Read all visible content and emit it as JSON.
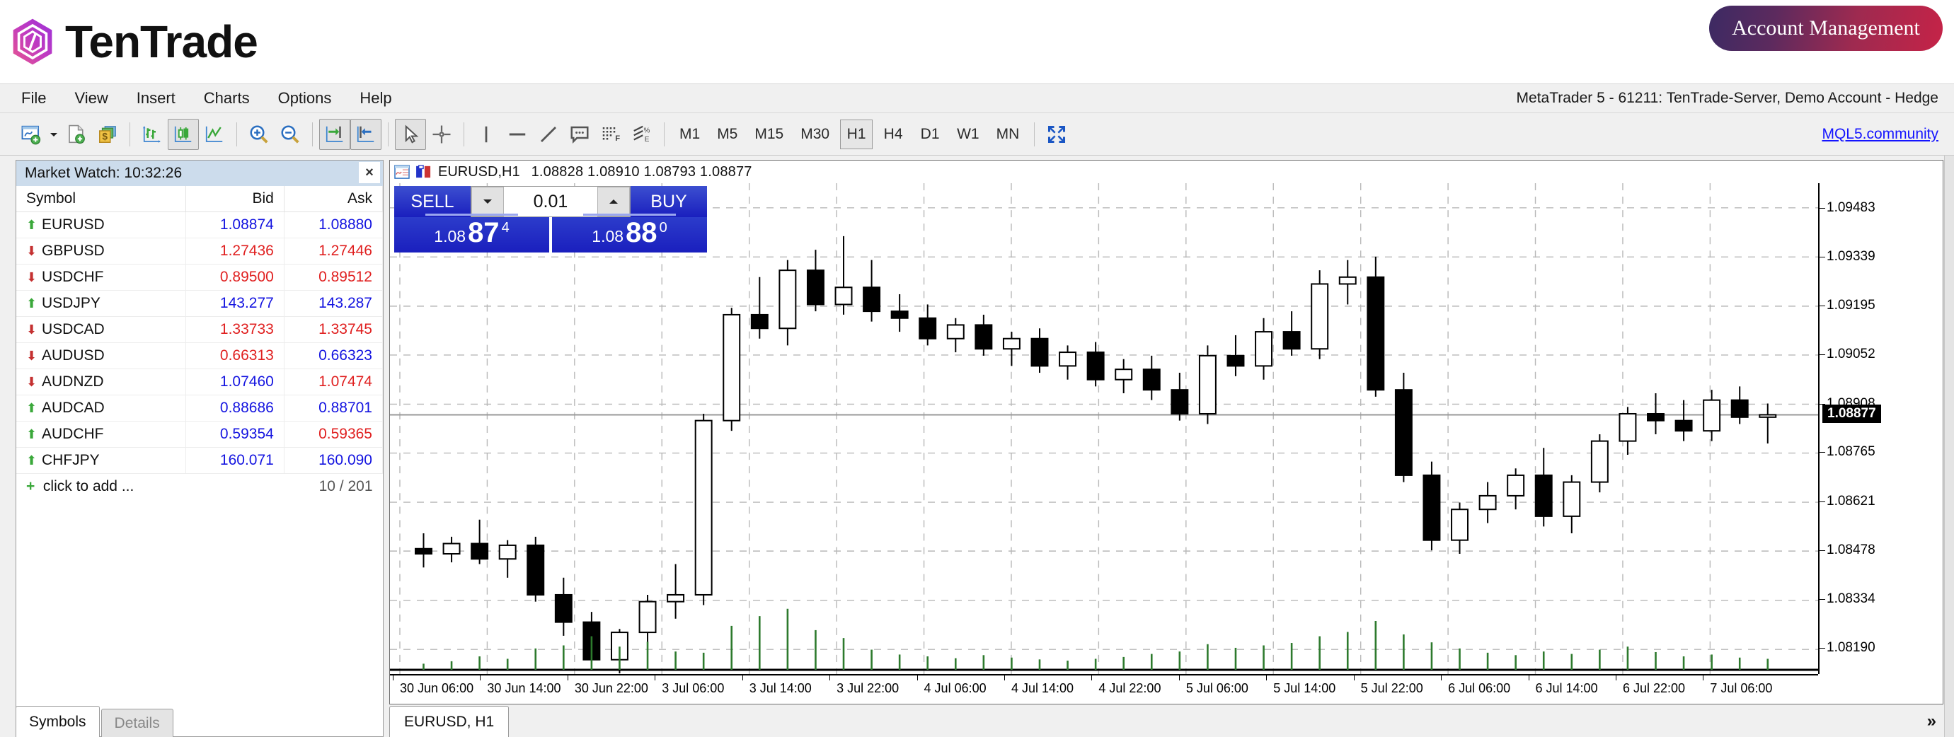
{
  "brand": {
    "name": "TenTrade",
    "logo_colors": {
      "start": "#e8568f",
      "mid": "#c13bc0",
      "end": "#9b30d9"
    },
    "account_button": "Account Management",
    "account_button_gradient": {
      "start": "#3c2a63",
      "end": "#c52347"
    }
  },
  "menu": {
    "items": [
      "File",
      "View",
      "Insert",
      "Charts",
      "Options",
      "Help"
    ],
    "connection_status": "MetaTrader 5 - 61211: TenTrade-Server, Demo Account - Hedge"
  },
  "toolbar": {
    "buttons": [
      {
        "name": "new-chart-icon",
        "tip": "New Chart"
      },
      {
        "name": "new-order-icon",
        "tip": "New Order"
      },
      {
        "name": "profiles-icon",
        "tip": "Profiles"
      },
      {
        "name": "bar-chart-icon",
        "tip": "Bar Chart"
      },
      {
        "name": "candlestick-chart-icon",
        "tip": "Candlesticks",
        "pressed": true
      },
      {
        "name": "line-chart-icon",
        "tip": "Line Chart"
      },
      {
        "name": "zoom-in-icon",
        "tip": "Zoom In"
      },
      {
        "name": "zoom-out-icon",
        "tip": "Zoom Out"
      },
      {
        "name": "shift-end-icon",
        "tip": "Shift End of Chart",
        "pressed": true
      },
      {
        "name": "auto-scroll-icon",
        "tip": "Auto Scroll",
        "pressed": true
      },
      {
        "name": "cursor-icon",
        "tip": "Cursor",
        "pressed": true
      },
      {
        "name": "crosshair-icon",
        "tip": "Crosshair"
      },
      {
        "name": "vertical-line-icon",
        "tip": "Vertical Line"
      },
      {
        "name": "horizontal-line-icon",
        "tip": "Horizontal Line"
      },
      {
        "name": "trendline-icon",
        "tip": "Trendline"
      },
      {
        "name": "text-label-icon",
        "tip": "Text Label"
      },
      {
        "name": "indicators-icon",
        "tip": "Indicators"
      },
      {
        "name": "fibonacci-icon",
        "tip": "Fibonacci"
      }
    ],
    "timeframes": [
      "M1",
      "M5",
      "M15",
      "M30",
      "H1",
      "H4",
      "D1",
      "W1",
      "MN"
    ],
    "active_timeframe": "H1",
    "fullscreen_icon": "fullscreen-icon",
    "mql5_link": "MQL5.community"
  },
  "market_watch": {
    "title": "Market Watch: 10:32:26",
    "close_label": "×",
    "columns": [
      "Symbol",
      "Bid",
      "Ask"
    ],
    "rows": [
      {
        "symbol": "EURUSD",
        "dir": "up",
        "bid": "1.08874",
        "bid_color": "up",
        "ask": "1.08880",
        "ask_color": "up"
      },
      {
        "symbol": "GBPUSD",
        "dir": "down",
        "bid": "1.27436",
        "bid_color": "down",
        "ask": "1.27446",
        "ask_color": "down"
      },
      {
        "symbol": "USDCHF",
        "dir": "down",
        "bid": "0.89500",
        "bid_color": "down",
        "ask": "0.89512",
        "ask_color": "down"
      },
      {
        "symbol": "USDJPY",
        "dir": "up",
        "bid": "143.277",
        "bid_color": "up",
        "ask": "143.287",
        "ask_color": "up"
      },
      {
        "symbol": "USDCAD",
        "dir": "down",
        "bid": "1.33733",
        "bid_color": "down",
        "ask": "1.33745",
        "ask_color": "down"
      },
      {
        "symbol": "AUDUSD",
        "dir": "down",
        "bid": "0.66313",
        "bid_color": "down",
        "ask": "0.66323",
        "ask_color": "up"
      },
      {
        "symbol": "AUDNZD",
        "dir": "down",
        "bid": "1.07460",
        "bid_color": "up",
        "ask": "1.07474",
        "ask_color": "down"
      },
      {
        "symbol": "AUDCAD",
        "dir": "up",
        "bid": "0.88686",
        "bid_color": "up",
        "ask": "0.88701",
        "ask_color": "up"
      },
      {
        "symbol": "AUDCHF",
        "dir": "up",
        "bid": "0.59354",
        "bid_color": "up",
        "ask": "0.59365",
        "ask_color": "down"
      },
      {
        "symbol": "CHFJPY",
        "dir": "up",
        "bid": "160.071",
        "bid_color": "up",
        "ask": "160.090",
        "ask_color": "up"
      }
    ],
    "add_row_label": "click to add ...",
    "symbol_count": "10 / 201",
    "tabs": [
      {
        "label": "Symbols",
        "active": true
      },
      {
        "label": "Details",
        "active": false
      }
    ]
  },
  "chart_window": {
    "symbol_timeframe": "EURUSD,H1",
    "ohlc": "1.08828 1.08910 1.08793 1.08877",
    "tab_label": "EURUSD, H1",
    "overflow_label": "»"
  },
  "one_click_trading": {
    "sell_label": "SELL",
    "buy_label": "BUY",
    "volume": "0.01",
    "sell_price": {
      "prefix": "1.08",
      "big": "87",
      "sup": "4"
    },
    "buy_price": {
      "prefix": "1.08",
      "big": "88",
      "sup": "0"
    },
    "down_arrow": "▼",
    "up_arrow": "▲"
  },
  "chart_data": {
    "type": "line",
    "title": "EURUSD,H1",
    "xlabel": "",
    "ylabel": "",
    "grid": true,
    "legend": false,
    "ylim": [
      1.08118,
      1.09555
    ],
    "price_ticks": [
      "1.09483",
      "1.09339",
      "1.09195",
      "1.09052",
      "1.08908",
      "1.08765",
      "1.08621",
      "1.08478",
      "1.08334",
      "1.08190"
    ],
    "current_price": "1.08877",
    "time_ticks": [
      "30 Jun 06:00",
      "30 Jun 14:00",
      "30 Jun 22:00",
      "3 Jul 06:00",
      "3 Jul 14:00",
      "3 Jul 22:00",
      "4 Jul 06:00",
      "4 Jul 14:00",
      "4 Jul 22:00",
      "5 Jul 06:00",
      "5 Jul 14:00",
      "5 Jul 22:00",
      "6 Jul 06:00",
      "6 Jul 14:00",
      "6 Jul 22:00",
      "7 Jul 06:00"
    ],
    "candles": [
      {
        "o": 1.08485,
        "h": 1.0853,
        "l": 1.0843,
        "c": 1.0847,
        "v": 0.1
      },
      {
        "o": 1.0847,
        "h": 1.0852,
        "l": 1.08445,
        "c": 1.085,
        "v": 0.14
      },
      {
        "o": 1.085,
        "h": 1.0857,
        "l": 1.0844,
        "c": 1.08455,
        "v": 0.22
      },
      {
        "o": 1.08455,
        "h": 1.0851,
        "l": 1.084,
        "c": 1.08495,
        "v": 0.18
      },
      {
        "o": 1.08495,
        "h": 1.0852,
        "l": 1.0833,
        "c": 1.0835,
        "v": 0.35
      },
      {
        "o": 1.0835,
        "h": 1.084,
        "l": 1.0823,
        "c": 1.0827,
        "v": 0.4
      },
      {
        "o": 1.0827,
        "h": 1.083,
        "l": 1.0814,
        "c": 1.0816,
        "v": 0.55
      },
      {
        "o": 1.0816,
        "h": 1.0825,
        "l": 1.0812,
        "c": 1.0824,
        "v": 0.38
      },
      {
        "o": 1.0824,
        "h": 1.0835,
        "l": 1.0821,
        "c": 1.0833,
        "v": 0.46
      },
      {
        "o": 1.0833,
        "h": 1.0844,
        "l": 1.0828,
        "c": 1.0835,
        "v": 0.3
      },
      {
        "o": 1.0835,
        "h": 1.0888,
        "l": 1.0832,
        "c": 1.0886,
        "v": 0.28
      },
      {
        "o": 1.0886,
        "h": 1.0919,
        "l": 1.0883,
        "c": 1.0917,
        "v": 0.72
      },
      {
        "o": 1.0917,
        "h": 1.0928,
        "l": 1.091,
        "c": 1.0913,
        "v": 0.88
      },
      {
        "o": 1.0913,
        "h": 1.0933,
        "l": 1.0908,
        "c": 1.093,
        "v": 1.0
      },
      {
        "o": 1.093,
        "h": 1.0936,
        "l": 1.0918,
        "c": 1.092,
        "v": 0.65
      },
      {
        "o": 1.092,
        "h": 1.094,
        "l": 1.0917,
        "c": 1.0925,
        "v": 0.52
      },
      {
        "o": 1.0925,
        "h": 1.0933,
        "l": 1.0915,
        "c": 1.0918,
        "v": 0.33
      },
      {
        "o": 1.0918,
        "h": 1.0923,
        "l": 1.0912,
        "c": 1.0916,
        "v": 0.25
      },
      {
        "o": 1.0916,
        "h": 1.092,
        "l": 1.0908,
        "c": 1.091,
        "v": 0.22
      },
      {
        "o": 1.091,
        "h": 1.0916,
        "l": 1.0906,
        "c": 1.0914,
        "v": 0.19
      },
      {
        "o": 1.0914,
        "h": 1.0917,
        "l": 1.0905,
        "c": 1.0907,
        "v": 0.24
      },
      {
        "o": 1.0907,
        "h": 1.0912,
        "l": 1.0902,
        "c": 1.091,
        "v": 0.2
      },
      {
        "o": 1.091,
        "h": 1.0913,
        "l": 1.09,
        "c": 1.0902,
        "v": 0.17
      },
      {
        "o": 1.0902,
        "h": 1.0908,
        "l": 1.0898,
        "c": 1.0906,
        "v": 0.15
      },
      {
        "o": 1.0906,
        "h": 1.0909,
        "l": 1.0896,
        "c": 1.0898,
        "v": 0.18
      },
      {
        "o": 1.0898,
        "h": 1.0904,
        "l": 1.0894,
        "c": 1.0901,
        "v": 0.21
      },
      {
        "o": 1.0901,
        "h": 1.0905,
        "l": 1.0892,
        "c": 1.0895,
        "v": 0.26
      },
      {
        "o": 1.0895,
        "h": 1.09,
        "l": 1.0886,
        "c": 1.0888,
        "v": 0.3
      },
      {
        "o": 1.0888,
        "h": 1.0908,
        "l": 1.0885,
        "c": 1.0905,
        "v": 0.42
      },
      {
        "o": 1.0905,
        "h": 1.0911,
        "l": 1.0899,
        "c": 1.0902,
        "v": 0.36
      },
      {
        "o": 1.0902,
        "h": 1.0916,
        "l": 1.0898,
        "c": 1.0912,
        "v": 0.4
      },
      {
        "o": 1.0912,
        "h": 1.0918,
        "l": 1.0905,
        "c": 1.0907,
        "v": 0.44
      },
      {
        "o": 1.0907,
        "h": 1.093,
        "l": 1.0904,
        "c": 1.0926,
        "v": 0.55
      },
      {
        "o": 1.0926,
        "h": 1.0933,
        "l": 1.092,
        "c": 1.0928,
        "v": 0.62
      },
      {
        "o": 1.0928,
        "h": 1.0934,
        "l": 1.0893,
        "c": 1.0895,
        "v": 0.8
      },
      {
        "o": 1.0895,
        "h": 1.09,
        "l": 1.0868,
        "c": 1.087,
        "v": 0.58
      },
      {
        "o": 1.087,
        "h": 1.0874,
        "l": 1.0848,
        "c": 1.0851,
        "v": 0.45
      },
      {
        "o": 1.0851,
        "h": 1.0862,
        "l": 1.0847,
        "c": 1.086,
        "v": 0.35
      },
      {
        "o": 1.086,
        "h": 1.0868,
        "l": 1.0856,
        "c": 1.0864,
        "v": 0.28
      },
      {
        "o": 1.0864,
        "h": 1.0872,
        "l": 1.086,
        "c": 1.087,
        "v": 0.24
      },
      {
        "o": 1.087,
        "h": 1.0878,
        "l": 1.0855,
        "c": 1.0858,
        "v": 0.3
      },
      {
        "o": 1.0858,
        "h": 1.087,
        "l": 1.0853,
        "c": 1.0868,
        "v": 0.26
      },
      {
        "o": 1.0868,
        "h": 1.0882,
        "l": 1.0865,
        "c": 1.088,
        "v": 0.33
      },
      {
        "o": 1.088,
        "h": 1.089,
        "l": 1.0876,
        "c": 1.0888,
        "v": 0.38
      },
      {
        "o": 1.0888,
        "h": 1.0894,
        "l": 1.0882,
        "c": 1.0886,
        "v": 0.29
      },
      {
        "o": 1.0886,
        "h": 1.0892,
        "l": 1.088,
        "c": 1.0883,
        "v": 0.22
      },
      {
        "o": 1.0883,
        "h": 1.0895,
        "l": 1.088,
        "c": 1.0892,
        "v": 0.25
      },
      {
        "o": 1.0892,
        "h": 1.0896,
        "l": 1.0885,
        "c": 1.0887,
        "v": 0.2
      },
      {
        "o": 1.0887,
        "h": 1.0891,
        "l": 1.08793,
        "c": 1.08877,
        "v": 0.18
      }
    ]
  }
}
